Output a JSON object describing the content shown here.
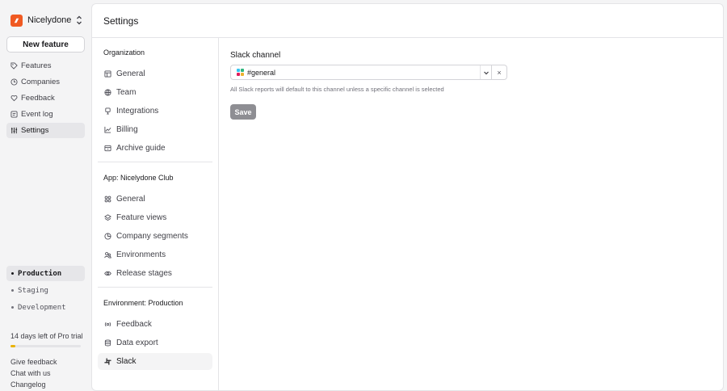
{
  "org": {
    "name": "Nicelydone C…",
    "logo_letter": "n",
    "brand_color": "#f05a22"
  },
  "sidebar": {
    "new_feature": "New feature",
    "items": [
      {
        "label": "Features",
        "icon": "tag-icon"
      },
      {
        "label": "Companies",
        "icon": "clock-icon"
      },
      {
        "label": "Feedback",
        "icon": "heart-icon"
      },
      {
        "label": "Event log",
        "icon": "list-icon"
      },
      {
        "label": "Settings",
        "icon": "sliders-icon",
        "active": true
      }
    ],
    "environments": [
      {
        "label": "Production",
        "active": true
      },
      {
        "label": "Staging"
      },
      {
        "label": "Development"
      }
    ],
    "trial": {
      "text": "14 days left of Pro trial",
      "progress_percent": 7,
      "color": "#eab308"
    },
    "links": [
      "Give feedback",
      "Chat with us",
      "Changelog"
    ]
  },
  "header": {
    "title": "Settings"
  },
  "subnav": {
    "groups": [
      {
        "title": "Organization",
        "items": [
          "General",
          "Team",
          "Integrations",
          "Billing",
          "Archive guide"
        ]
      },
      {
        "title": "App: Nicelydone Club",
        "items": [
          "General",
          "Feature views",
          "Company segments",
          "Environments",
          "Release stages"
        ]
      },
      {
        "title": "Environment: Production",
        "items": [
          "Feedback",
          "Data export",
          "Slack"
        ]
      }
    ]
  },
  "form": {
    "label": "Slack channel",
    "value": "#general",
    "clear": "×",
    "help": "All Slack reports will default to this channel unless a specific channel is selected",
    "save": "Save"
  }
}
